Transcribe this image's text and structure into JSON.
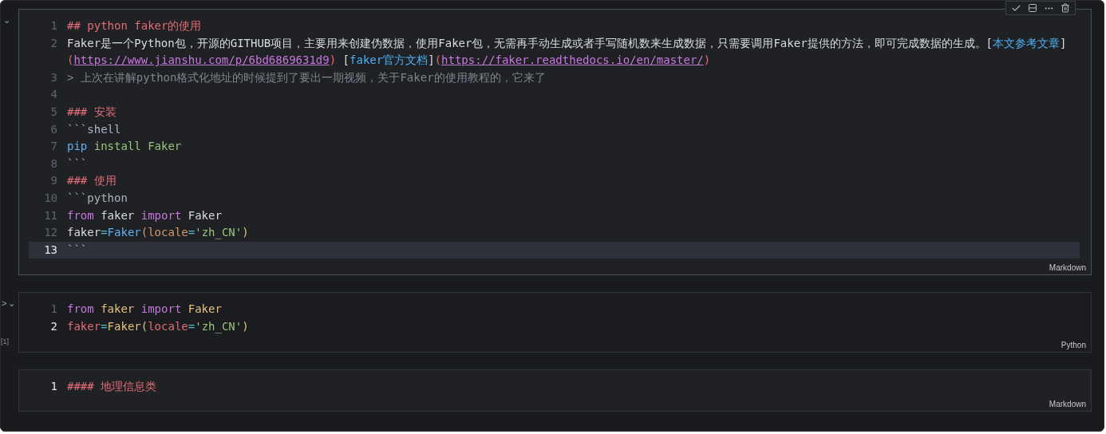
{
  "cells": [
    {
      "kind": "markdown",
      "language": "Markdown",
      "focused": true,
      "collapse": "⌄",
      "toolbar": true,
      "lines": [
        {
          "n": "1",
          "current": false,
          "tokens": [
            {
              "t": "## python faker的使用",
              "kind": "heading"
            }
          ]
        },
        {
          "n": "2",
          "current": false,
          "tokens": [
            {
              "t": "Faker是一个Python包，开源的GITHUB项目，主要用来创建伪数据，使用Faker包，无需再手动生成或者手写随机数来生成数据，只需要调用Faker提供的方法，即可完成数据的生成。",
              "kind": "plain"
            },
            {
              "t": "[",
              "kind": "plain"
            },
            {
              "t": "本文参考文章",
              "kind": "label"
            },
            {
              "t": "]",
              "kind": "plain"
            },
            {
              "t": "(",
              "kind": "paren"
            },
            {
              "t": "https://www.jianshu.com/p/6bd6869631d9",
              "kind": "url"
            },
            {
              "t": ")",
              "kind": "paren"
            },
            {
              "t": " [",
              "kind": "plain"
            },
            {
              "t": "faker官方文档",
              "kind": "label"
            },
            {
              "t": "]",
              "kind": "plain"
            },
            {
              "t": "(",
              "kind": "paren"
            },
            {
              "t": "https://faker.readthedocs.io/en/master/",
              "kind": "url"
            },
            {
              "t": ")",
              "kind": "paren"
            }
          ]
        },
        {
          "n": "3",
          "current": false,
          "tokens": [
            {
              "t": "> 上次在讲解python格式化地址的时候提到了要出一期视频，关于Faker的使用教程的，它来了",
              "kind": "quote"
            }
          ]
        },
        {
          "n": "4",
          "current": false
        },
        {
          "n": "5",
          "current": false,
          "tokens": [
            {
              "t": "### 安装",
              "kind": "heading"
            }
          ]
        },
        {
          "n": "6",
          "current": false,
          "tokens": [
            {
              "t": "```shell",
              "kind": "dim"
            }
          ]
        },
        {
          "n": "7",
          "current": false,
          "tokens": [
            {
              "t": "pip",
              "kind": "func"
            },
            {
              "t": " install Faker",
              "kind": "string"
            }
          ]
        },
        {
          "n": "8",
          "current": false,
          "tokens": [
            {
              "t": "```",
              "kind": "dim"
            }
          ]
        },
        {
          "n": "9",
          "current": false,
          "tokens": [
            {
              "t": "### 使用",
              "kind": "heading"
            }
          ]
        },
        {
          "n": "10",
          "current": false,
          "tokens": [
            {
              "t": "```python",
              "kind": "dim"
            }
          ]
        },
        {
          "n": "11",
          "current": false,
          "tokens": [
            {
              "t": "from",
              "kind": "keyword"
            },
            {
              "t": " faker ",
              "kind": "plain"
            },
            {
              "t": "import",
              "kind": "keyword"
            },
            {
              "t": " Faker",
              "kind": "plain"
            }
          ]
        },
        {
          "n": "12",
          "current": false,
          "tokens": [
            {
              "t": "faker",
              "kind": "plain"
            },
            {
              "t": "=",
              "kind": "op"
            },
            {
              "t": "Faker",
              "kind": "func"
            },
            {
              "t": "(locale",
              "kind": "param"
            },
            {
              "t": "=",
              "kind": "op"
            },
            {
              "t": "'zh_CN'",
              "kind": "string"
            },
            {
              "t": ")",
              "kind": "class"
            }
          ]
        },
        {
          "n": "13",
          "current": true,
          "tokens": [
            {
              "t": "```",
              "kind": "dim"
            }
          ]
        }
      ]
    },
    {
      "kind": "code",
      "language": "Python",
      "focused": false,
      "collapse": "⌄",
      "run": ">",
      "count": "[1]",
      "toolbar": false,
      "lines": [
        {
          "n": "1",
          "current": false,
          "tokens": [
            {
              "t": "from",
              "kind": "keyword"
            },
            {
              "t": " faker ",
              "kind": "class"
            },
            {
              "t": "import",
              "kind": "keyword"
            },
            {
              "t": " Faker",
              "kind": "class"
            }
          ]
        },
        {
          "n": "2",
          "current": true,
          "tokens": [
            {
              "t": "faker",
              "kind": "variable"
            },
            {
              "t": "=",
              "kind": "op"
            },
            {
              "t": "Faker",
              "kind": "class"
            },
            {
              "t": "(",
              "kind": "class"
            },
            {
              "t": "locale",
              "kind": "variable"
            },
            {
              "t": "=",
              "kind": "op"
            },
            {
              "t": "'zh_CN'",
              "kind": "string"
            },
            {
              "t": ")",
              "kind": "class"
            }
          ]
        }
      ]
    },
    {
      "kind": "markdown",
      "language": "Markdown",
      "focused": false,
      "toolbar": false,
      "lines": [
        {
          "n": "1",
          "current": true,
          "tokens": [
            {
              "t": "#### 地理信息类",
              "kind": "heading"
            }
          ]
        }
      ]
    }
  ]
}
